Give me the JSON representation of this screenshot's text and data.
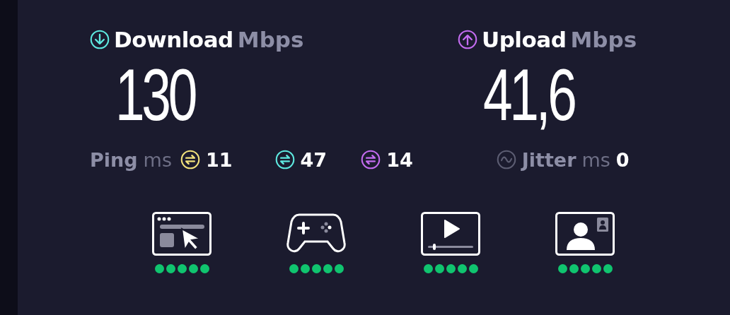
{
  "download": {
    "label": "Download",
    "unit": "Mbps",
    "value": "130"
  },
  "upload": {
    "label": "Upload",
    "unit": "Mbps",
    "value": "41,6"
  },
  "ping": {
    "label": "Ping",
    "unit": "ms",
    "readings": [
      {
        "value": "11",
        "color": "#f2e27c"
      },
      {
        "value": "47",
        "color": "#5ee9e0"
      },
      {
        "value": "14",
        "color": "#c46cf0"
      }
    ]
  },
  "jitter": {
    "label": "Jitter",
    "unit": "ms",
    "value": "0"
  },
  "experiences": [
    {
      "kind": "browsing",
      "stars": 5
    },
    {
      "kind": "gaming",
      "stars": 5
    },
    {
      "kind": "streaming",
      "stars": 5
    },
    {
      "kind": "video-call",
      "stars": 5
    }
  ]
}
